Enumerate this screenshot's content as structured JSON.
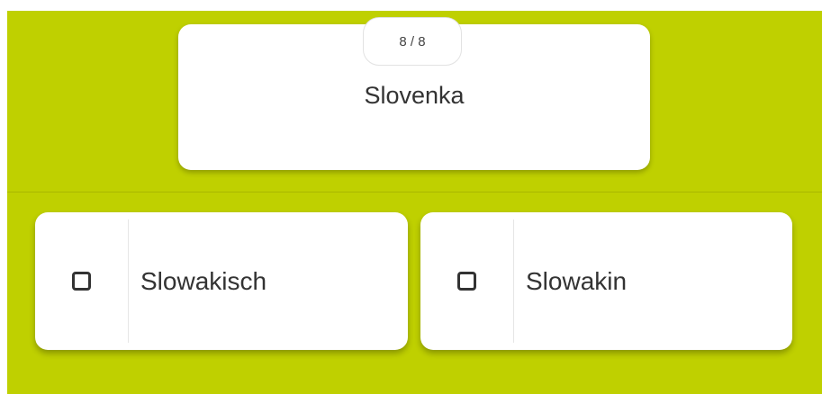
{
  "quiz": {
    "counter": "8 / 8",
    "question": "Slovenka",
    "answers": [
      {
        "label": "Slowakisch",
        "checked": false
      },
      {
        "label": "Slowakin",
        "checked": false
      }
    ]
  },
  "colors": {
    "background": "#bfd000",
    "card": "#ffffff",
    "text": "#333333"
  }
}
